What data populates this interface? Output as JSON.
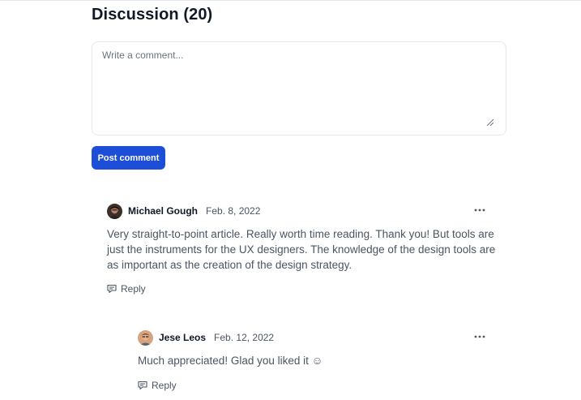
{
  "discussion": {
    "title": "Discussion (20)",
    "comment_placeholder": "Write a comment...",
    "post_label": "Post comment"
  },
  "comments": [
    {
      "author": "Michael Gough",
      "date": "Feb. 8, 2022",
      "text": "Very straight-to-point article. Really worth time reading. Thank you! But tools are just the instruments for the UX designers. The knowledge of the design tools are as important as the creation of the design strategy.",
      "reply_label": "Reply",
      "avatar_icon": "avatar-michael-gough"
    },
    {
      "author": "Jese Leos",
      "date": "Feb. 12, 2022",
      "text": "Much appreciated! Glad you liked it ☺",
      "reply_label": "Reply",
      "avatar_icon": "avatar-jese-leos"
    }
  ],
  "colors": {
    "accent": "#1d4ed8",
    "text": "#111827",
    "muted": "#4b5563",
    "border": "#e5e7eb"
  }
}
